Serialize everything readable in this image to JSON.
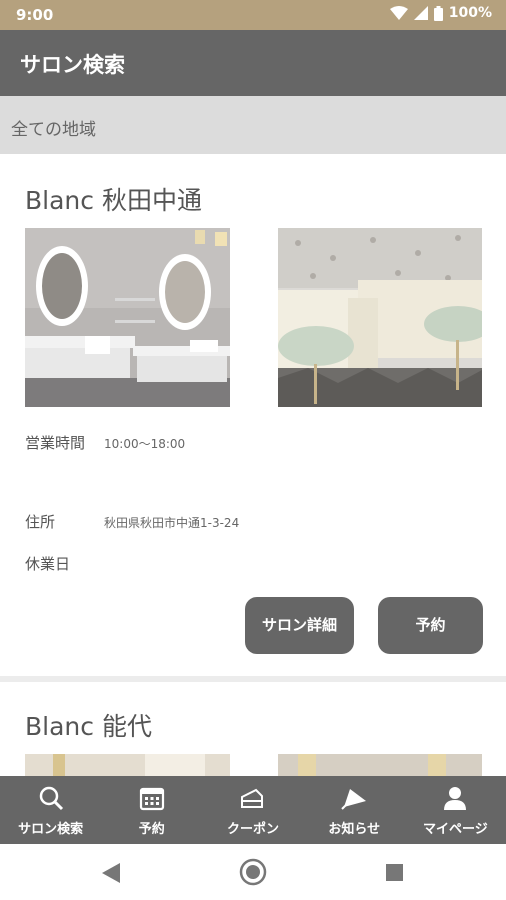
{
  "status": {
    "time": "9:00",
    "battery": "100%"
  },
  "app_bar": {
    "title": "サロン検索"
  },
  "region": {
    "label": "全ての地域"
  },
  "salons": [
    {
      "name": "Blanc 秋田中通",
      "hours_label": "営業時間",
      "hours_value": "10:00～18:00",
      "address_label": "住所",
      "address_value": "秋田県秋田市中通1-3-24",
      "holiday_label": "休業日",
      "detail_button": "サロン詳細",
      "reserve_button": "予約"
    },
    {
      "name": "Blanc 能代"
    }
  ],
  "nav": {
    "items": [
      {
        "label": "サロン検索",
        "icon": "search-icon"
      },
      {
        "label": "予約",
        "icon": "calendar-icon"
      },
      {
        "label": "クーポン",
        "icon": "coupon-icon"
      },
      {
        "label": "お知らせ",
        "icon": "megaphone-icon"
      },
      {
        "label": "マイページ",
        "icon": "person-icon"
      }
    ]
  },
  "colors": {
    "status_bar": "#b5a17e",
    "app_bar": "#666666",
    "region_bar": "#dcdcdc",
    "button": "#666666"
  }
}
